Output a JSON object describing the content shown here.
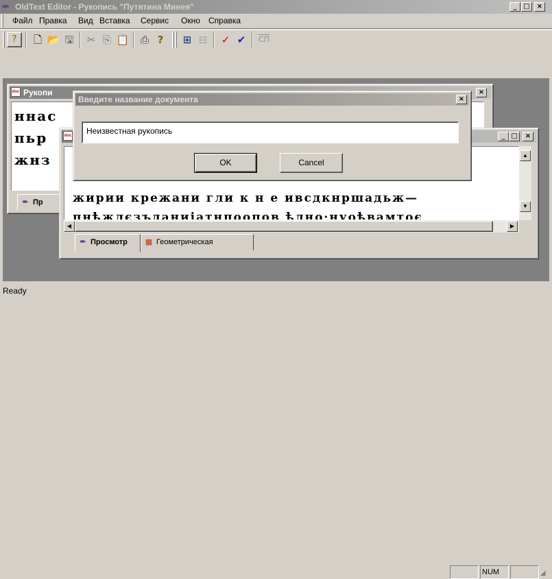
{
  "app": {
    "title": "OldText Editor - Рукопись \"Путятина Минея\"",
    "icon": "quill-pen-icon"
  },
  "menu": [
    "Файл",
    "Правка",
    "Вид",
    "Вставка",
    "Сервис",
    "Окно",
    "Справка"
  ],
  "toolbar": {
    "icons": [
      "context-help-icon",
      "new-document-icon",
      "open-folder-icon",
      "save-icon",
      "cut-icon",
      "copy-icon",
      "paste-icon",
      "print-icon",
      "help-icon",
      "layout-icon",
      "table-icon",
      "check-icon",
      "double-check-icon",
      "old-slavonic-icon"
    ],
    "slavonic_label": "СП"
  },
  "back_window": {
    "title": "Рукопи",
    "text_lines": [
      "ннас",
      "пьр",
      "жнз"
    ],
    "tab_label": "Пр"
  },
  "front_window": {
    "text_line1": "жирии крежани гли к н е ивсдкнршадьж—",
    "text_line2": "пнѣжлєзъданиіатнпоопов ѣлно·нуоѣвамтоє",
    "tabs": [
      "Просмотр",
      "Геометрическая"
    ]
  },
  "dialog": {
    "title": "Введите название документа",
    "input_value": "Неизвестная рукопись",
    "ok_label": "OK",
    "cancel_label": "Cancel"
  },
  "status": {
    "text": "Ready",
    "num": "NUM"
  },
  "colors": {
    "active_title": "#0a246a",
    "inactive_title": "#808080",
    "face": "#d4d0c8",
    "mdi_bg": "#808080"
  }
}
